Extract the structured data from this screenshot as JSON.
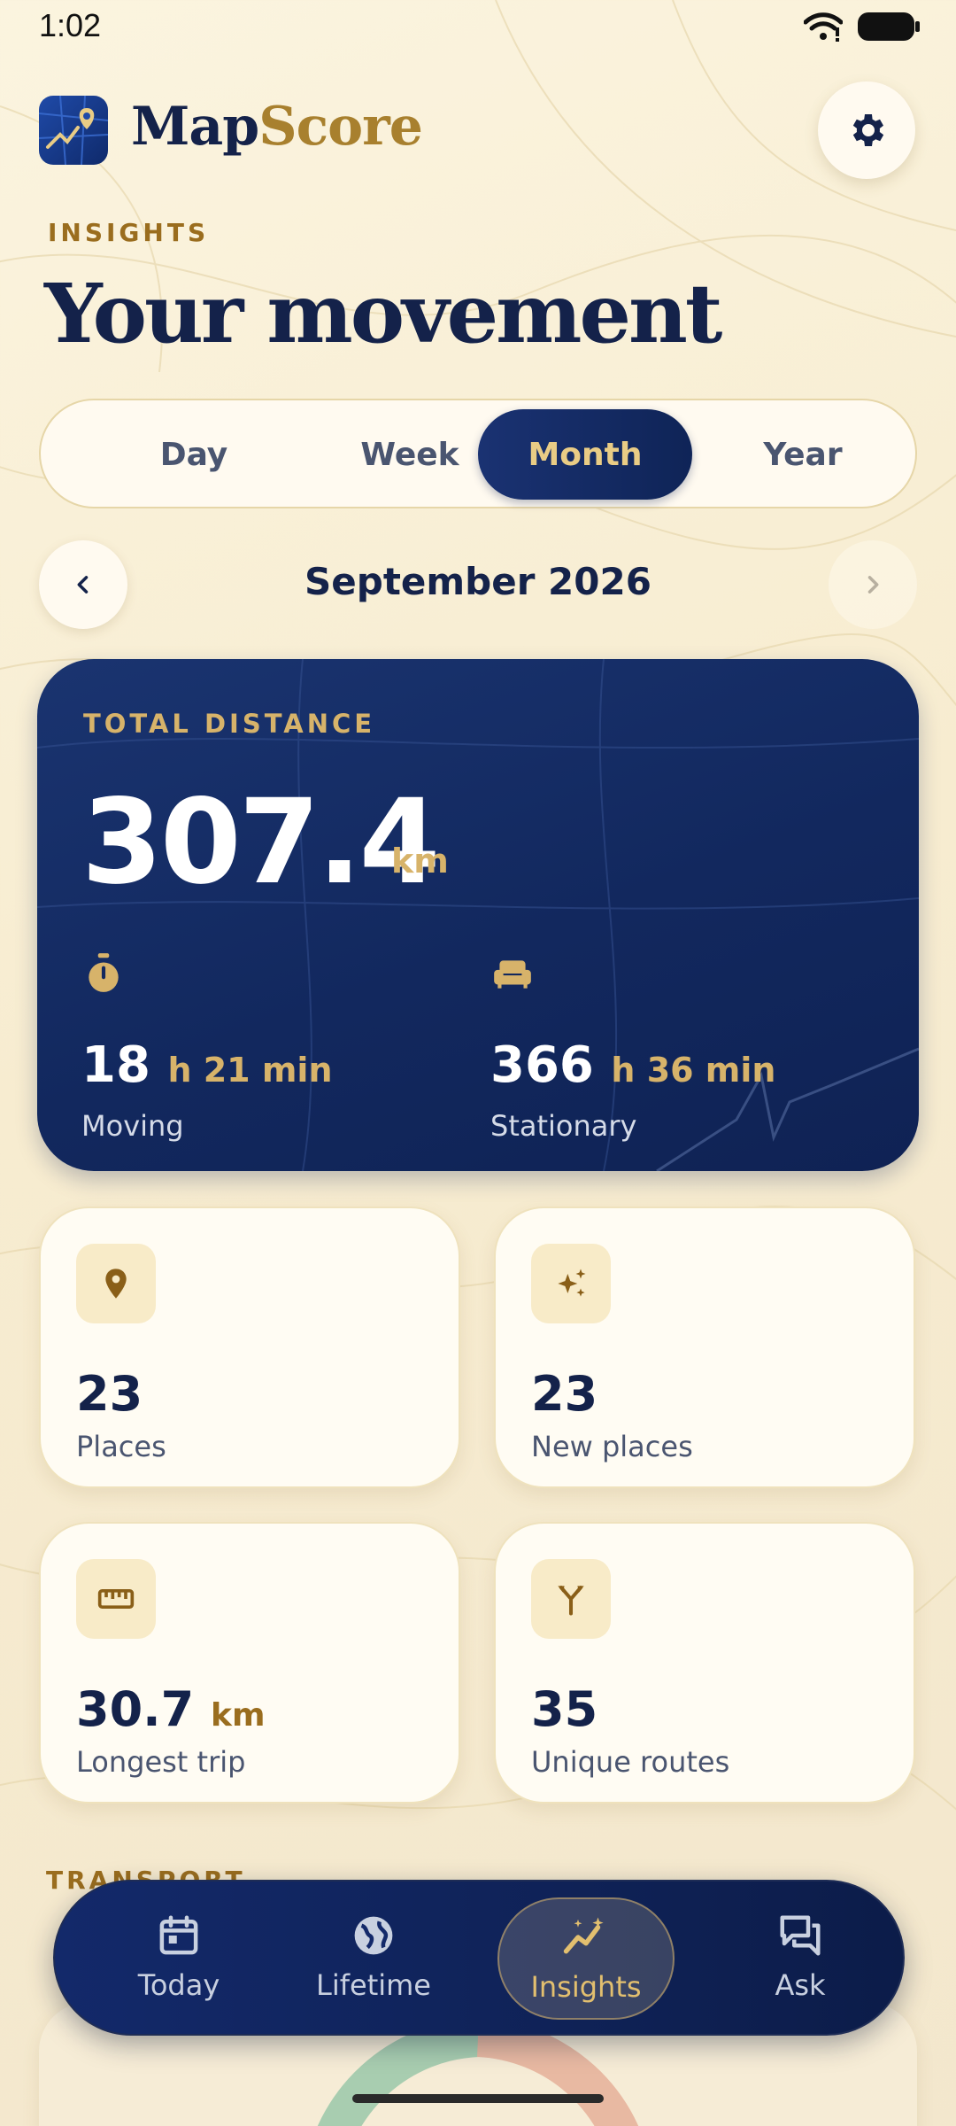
{
  "status_bar": {
    "time": "1:02",
    "icons": [
      "wifi-icon",
      "battery-icon"
    ]
  },
  "header": {
    "app_name_part1": "Map",
    "app_name_part2": "Score",
    "settings_icon": "gear-icon"
  },
  "section": {
    "label": "INSIGHTS"
  },
  "title": "Your movement",
  "period_tabs": {
    "items": [
      "Day",
      "Week",
      "Month",
      "Year"
    ],
    "selected": "Month"
  },
  "month_nav": {
    "label": "September 2026",
    "prev_icon": "chevron-left-icon",
    "next_icon": "chevron-right-icon"
  },
  "distance_card": {
    "label": "TOTAL DISTANCE",
    "value": "307.4",
    "unit": "km",
    "moving": {
      "num": "18",
      "unit": "h 21 min",
      "caption": "Moving",
      "icon": "stopwatch-icon"
    },
    "stationary": {
      "num": "366",
      "unit": "h 36 min",
      "caption": "Stationary",
      "icon": "couch-icon"
    }
  },
  "stats": [
    {
      "value": "23",
      "unit": "",
      "caption": "Places",
      "icon": "location-pin-icon"
    },
    {
      "value": "23",
      "unit": "",
      "caption": "New places",
      "icon": "sparkle-icon"
    },
    {
      "value": "30.7",
      "unit": "km",
      "caption": "Longest trip",
      "icon": "ruler-icon"
    },
    {
      "value": "35",
      "unit": "",
      "caption": "Unique routes",
      "icon": "route-fork-icon"
    }
  ],
  "transport": {
    "label": "TRANSPORT"
  },
  "bottom_nav": {
    "items": [
      {
        "label": "Today",
        "icon": "calendar-icon"
      },
      {
        "label": "Lifetime",
        "icon": "globe-icon"
      },
      {
        "label": "Insights",
        "icon": "insights-chart-icon"
      },
      {
        "label": "Ask",
        "icon": "chat-bubbles-icon"
      }
    ],
    "selected": "Insights"
  },
  "colors": {
    "navy": "#14224a",
    "gold": "#d7b36a",
    "cream": "#fffcf3"
  }
}
